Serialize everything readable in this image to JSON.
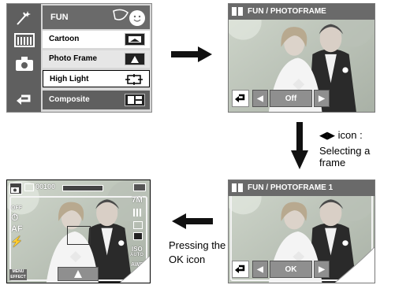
{
  "menu": {
    "title": "FUN",
    "items": [
      {
        "label": "Cartoon"
      },
      {
        "label": "Photo Frame"
      },
      {
        "label": "High Light"
      },
      {
        "label": "Composite"
      }
    ]
  },
  "frame_preview": {
    "title": "FUN / PHOTOFRAME",
    "value": "Off"
  },
  "frame_selected": {
    "title": "FUN / PHOTOFRAME 1",
    "value": "OK"
  },
  "captions": {
    "icon_label": "icon :",
    "selecting_frame": "Selecting a frame",
    "pressing_line1": "Pressing the",
    "pressing_line2": "OK icon"
  },
  "camera_view": {
    "counter": "00100",
    "size": "7M",
    "iso": "ISO",
    "iso_mode": "AUTO",
    "awb": "AWB",
    "af": "AF",
    "off": "OFF",
    "menu_label_1": "MENU",
    "menu_label_2": "EFFECT"
  },
  "colors": {
    "accent_dark": "#5f5f5f",
    "bar_grey": "#6a6a6a"
  }
}
